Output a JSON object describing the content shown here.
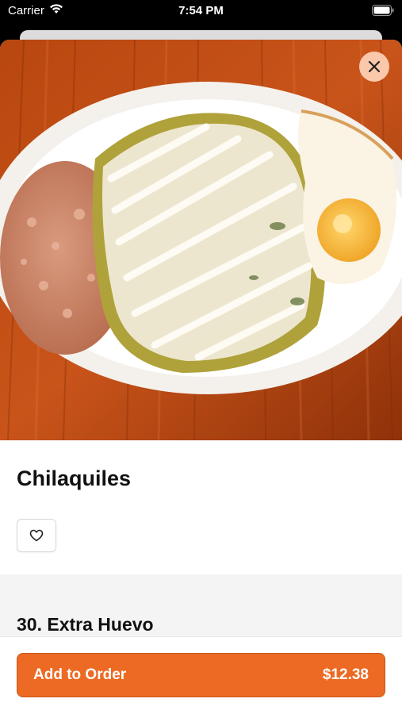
{
  "status_bar": {
    "carrier": "Carrier",
    "time": "7:54 PM",
    "wifi_icon": "wifi-icon",
    "battery_icon": "battery-icon"
  },
  "item": {
    "name": "Chilaquiles",
    "image_icon": "food-photo",
    "close_icon": "close-icon",
    "favorite_icon": "heart-icon"
  },
  "section": {
    "title": "30. Extra Huevo"
  },
  "footer": {
    "add_label": "Add to Order",
    "price": "$12.38"
  },
  "colors": {
    "accent": "#ec6a23",
    "close_bg": "#ffd2b9"
  }
}
